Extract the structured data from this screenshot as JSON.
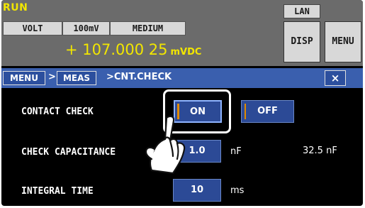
{
  "status": {
    "run_label": "RUN",
    "lan_label": "LAN",
    "function": "VOLT",
    "range": "100mV",
    "speed": "MEDIUM",
    "disp_label": "DISP",
    "menu_label": "MENU",
    "reading_value": "+ 107.000 25",
    "reading_unit": "mVDC"
  },
  "breadcrumb": {
    "menu": "MENU",
    "sep": ">",
    "meas": "MEAS",
    "current": ">CNT.CHECK",
    "close": "×"
  },
  "settings": {
    "contact_check": {
      "label": "CONTACT CHECK",
      "options": [
        "ON",
        "OFF"
      ],
      "selected": "ON"
    },
    "check_capacitance": {
      "label": "CHECK CAPACITANCE",
      "value": "1.0",
      "unit": "nF",
      "measured": "32.5 nF"
    },
    "integral_time": {
      "label": "INTEGRAL TIME",
      "value": "10",
      "unit": "ms"
    }
  },
  "colors": {
    "reading_text": "#f2e600",
    "status_bg": "#6b6b6b",
    "nav_bar": "#3a5fae",
    "button_blue": "#2c4a96",
    "selected_marker": "#e08a00"
  },
  "icons": {
    "pointer": "pointing-hand-icon",
    "close": "close-icon"
  }
}
